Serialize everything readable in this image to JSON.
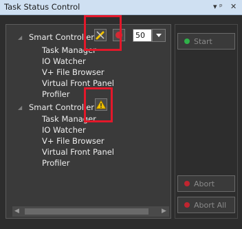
{
  "window": {
    "title": "Task Status Control",
    "pin_glyph": "▾ ⯐",
    "close_glyph": "✕"
  },
  "tree": {
    "controllers": [
      {
        "label": "Smart Controller 0",
        "status_icon": "brush-icon",
        "children": [
          "Task Manager",
          "IO Watcher",
          "V+ File Browser",
          "Virtual Front Panel",
          "Profiler"
        ]
      },
      {
        "label": "Smart Controller 1",
        "status_icon": "warning-icon",
        "children": [
          "Task Manager",
          "IO Watcher",
          "V+ File Browser",
          "Virtual Front Panel",
          "Profiler"
        ]
      }
    ],
    "speed": {
      "value": "50",
      "icon": "chevron-down-icon"
    }
  },
  "actions": {
    "start": {
      "label": "Start",
      "led_color": "#2fb24a"
    },
    "abort": {
      "label": "Abort",
      "led_color": "#c0252f"
    },
    "abort_all": {
      "label": "Abort All",
      "led_color": "#c0252f"
    }
  },
  "colors": {
    "panel_bg": "#3a3a3a",
    "title_bg": "#cfe0f2",
    "highlight": "#e3182a",
    "warning": "#f2c200"
  }
}
